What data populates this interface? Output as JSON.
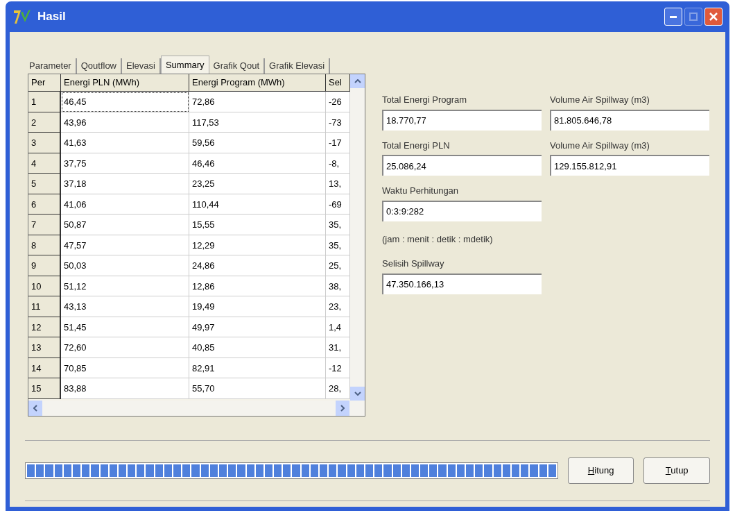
{
  "window": {
    "title": "Hasil",
    "controls": [
      {
        "kind": "minimize",
        "disabled": false
      },
      {
        "kind": "maximize",
        "disabled": true
      },
      {
        "kind": "close",
        "disabled": false
      }
    ]
  },
  "tabs": [
    {
      "label": "Parameter",
      "selected": false
    },
    {
      "label": "Qoutflow",
      "selected": false
    },
    {
      "label": "Elevasi",
      "selected": false
    },
    {
      "label": "Summary",
      "selected": true
    },
    {
      "label": "Grafik Qout",
      "selected": false
    },
    {
      "label": "Grafik Elevasi",
      "selected": false
    }
  ],
  "table": {
    "columns": [
      "Per",
      "Energi PLN (MWh)",
      "Energi Program (MWh)",
      "Sel"
    ],
    "rows": [
      [
        "1",
        "46,45",
        "72,86",
        "-26"
      ],
      [
        "2",
        "43,96",
        "117,53",
        "-73"
      ],
      [
        "3",
        "41,63",
        "59,56",
        "-17"
      ],
      [
        "4",
        "37,75",
        "46,46",
        "-8,"
      ],
      [
        "5",
        "37,18",
        "23,25",
        "13,"
      ],
      [
        "6",
        "41,06",
        "110,44",
        "-69"
      ],
      [
        "7",
        "50,87",
        "15,55",
        "35,"
      ],
      [
        "8",
        "47,57",
        "12,29",
        "35,"
      ],
      [
        "9",
        "50,03",
        "24,86",
        "25,"
      ],
      [
        "10",
        "51,12",
        "12,86",
        "38,"
      ],
      [
        "11",
        "43,13",
        "19,49",
        "23,"
      ],
      [
        "12",
        "51,45",
        "49,97",
        "1,4"
      ],
      [
        "13",
        "72,60",
        "40,85",
        "31,"
      ],
      [
        "14",
        "70,85",
        "82,91",
        "-12"
      ],
      [
        "15",
        "83,88",
        "55,70",
        "28,"
      ]
    ]
  },
  "summary": {
    "left": [
      {
        "kind": "field",
        "label": "Total Energi Program",
        "value": "18.770,77"
      },
      {
        "kind": "field",
        "label": "Total Energi PLN",
        "value": "25.086,24"
      },
      {
        "kind": "field",
        "label": "Waktu Perhitungan",
        "value": "0:3:9:282"
      },
      {
        "kind": "note",
        "label": "(jam : menit : detik : mdetik)"
      },
      {
        "kind": "field",
        "label": "Selisih Spillway",
        "value": "47.350.166,13"
      }
    ],
    "right": [
      {
        "kind": "field",
        "label": "Volume Air Spillway (m3)",
        "value": "81.805.646,78"
      },
      {
        "kind": "field",
        "label": "Volume Air Spillway (m3)",
        "value": "129.155.812,91"
      }
    ]
  },
  "progress": {
    "level": 1
  },
  "buttons": [
    "Hitung",
    "Tutup"
  ]
}
